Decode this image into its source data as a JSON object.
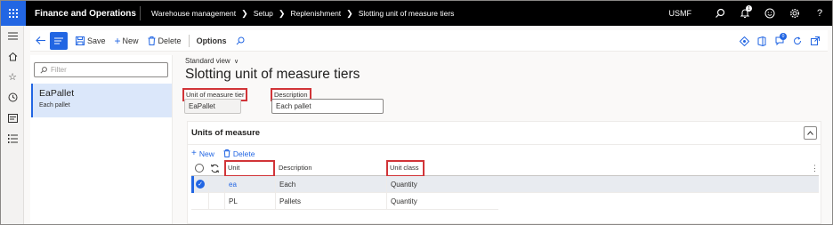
{
  "topbar": {
    "app_name": "Finance and Operations",
    "breadcrumbs": [
      "Warehouse management",
      "Setup",
      "Replenishment",
      "Slotting unit of measure tiers"
    ],
    "company": "USMF",
    "notification_count": "1"
  },
  "actions": {
    "save": "Save",
    "new": "New",
    "delete": "Delete",
    "options": "Options",
    "attachments_count": "0"
  },
  "list": {
    "filter_placeholder": "Filter",
    "items": [
      {
        "title": "EaPallet",
        "subtitle": "Each pallet"
      }
    ]
  },
  "details": {
    "view": "Standard view",
    "title": "Slotting unit of measure tiers",
    "fields": {
      "tier_label": "Unit of measure tier",
      "tier_value": "EaPallet",
      "description_label": "Description",
      "description_value": "Each pallet"
    }
  },
  "fasttab": {
    "title": "Units of measure",
    "new": "New",
    "delete": "Delete",
    "columns": {
      "unit": "Unit",
      "description": "Description",
      "unit_class": "Unit class"
    },
    "rows": [
      {
        "unit": "ea",
        "description": "Each",
        "unit_class": "Quantity",
        "selected": true
      },
      {
        "unit": "PL",
        "description": "Pallets",
        "unit_class": "Quantity",
        "selected": false
      }
    ]
  },
  "colors": {
    "accent": "#2266e3",
    "highlight": "#d13438",
    "selected_row": "#e8ebf0",
    "topbar": "#000000"
  }
}
